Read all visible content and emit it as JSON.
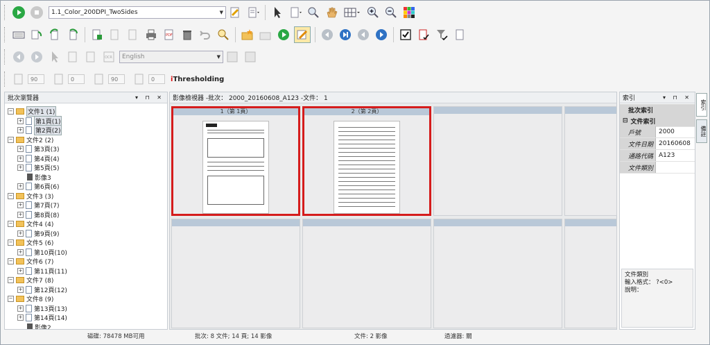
{
  "toolbar1": {
    "profile": "1.1_Color_200DPI_TwoSides"
  },
  "toolbar3": {
    "language": "English"
  },
  "toolbar4": {
    "rotate_left_value": "90",
    "value_2": "0",
    "rotate_right_value": "90",
    "value_4": "0",
    "ithresholding_i": "i",
    "ithresholding_rest": "Thresholding"
  },
  "batch_browser": {
    "title": "批次瀏覽器",
    "tree": [
      {
        "label": "文件1 (1)",
        "level": 0,
        "type": "folder",
        "selected": true
      },
      {
        "label": "第1頁(1)",
        "level": 1,
        "type": "page",
        "selected": true
      },
      {
        "label": "第2頁(2)",
        "level": 1,
        "type": "page",
        "selected": true
      },
      {
        "label": "文件2 (2)",
        "level": 0,
        "type": "folder"
      },
      {
        "label": "第3頁(3)",
        "level": 1,
        "type": "page"
      },
      {
        "label": "第4頁(4)",
        "level": 1,
        "type": "page"
      },
      {
        "label": "第5頁(5)",
        "level": 1,
        "type": "page"
      },
      {
        "label": "影像3",
        "level": 2,
        "type": "image"
      },
      {
        "label": "第6頁(6)",
        "level": 1,
        "type": "page"
      },
      {
        "label": "文件3 (3)",
        "level": 0,
        "type": "folder"
      },
      {
        "label": "第7頁(7)",
        "level": 1,
        "type": "page"
      },
      {
        "label": "第8頁(8)",
        "level": 1,
        "type": "page"
      },
      {
        "label": "文件4 (4)",
        "level": 0,
        "type": "folder"
      },
      {
        "label": "第9頁(9)",
        "level": 1,
        "type": "page"
      },
      {
        "label": "文件5 (6)",
        "level": 0,
        "type": "folder"
      },
      {
        "label": "第10頁(10)",
        "level": 1,
        "type": "page"
      },
      {
        "label": "文件6 (7)",
        "level": 0,
        "type": "folder"
      },
      {
        "label": "第11頁(11)",
        "level": 1,
        "type": "page"
      },
      {
        "label": "文件7 (8)",
        "level": 0,
        "type": "folder"
      },
      {
        "label": "第12頁(12)",
        "level": 1,
        "type": "page"
      },
      {
        "label": "文件8 (9)",
        "level": 0,
        "type": "folder"
      },
      {
        "label": "第13頁(13)",
        "level": 1,
        "type": "page"
      },
      {
        "label": "第14頁(14)",
        "level": 1,
        "type": "page"
      },
      {
        "label": "影像2",
        "level": 2,
        "type": "image"
      }
    ]
  },
  "image_viewer": {
    "title": "影像檢視器 -批次： 2000_20160608_A123 -文件： 1",
    "thumbs": [
      {
        "caption": "1（第 1頁）"
      },
      {
        "caption": "2（第 2頁）"
      }
    ]
  },
  "index_panel": {
    "title": "索引",
    "batch_index": "批次索引",
    "doc_index": "文件索引",
    "fields": [
      {
        "key": "戶號",
        "value": "2000"
      },
      {
        "key": "文件日期",
        "value": "20160608"
      },
      {
        "key": "通路代碼",
        "value": "A123"
      },
      {
        "key": "文件類別",
        "value": ""
      }
    ],
    "desc_title": "文件類別",
    "desc_format": "輸入格式： ?<0>",
    "desc_note": "說明："
  },
  "side_tabs": [
    "索引",
    "備註"
  ],
  "status": {
    "disk": "磁碟: 78478 MB可用",
    "batch": "批次: 8 文件; 14 頁; 14 影像",
    "doc": "文件: 2 影像",
    "filter": "過濾器: 關"
  }
}
